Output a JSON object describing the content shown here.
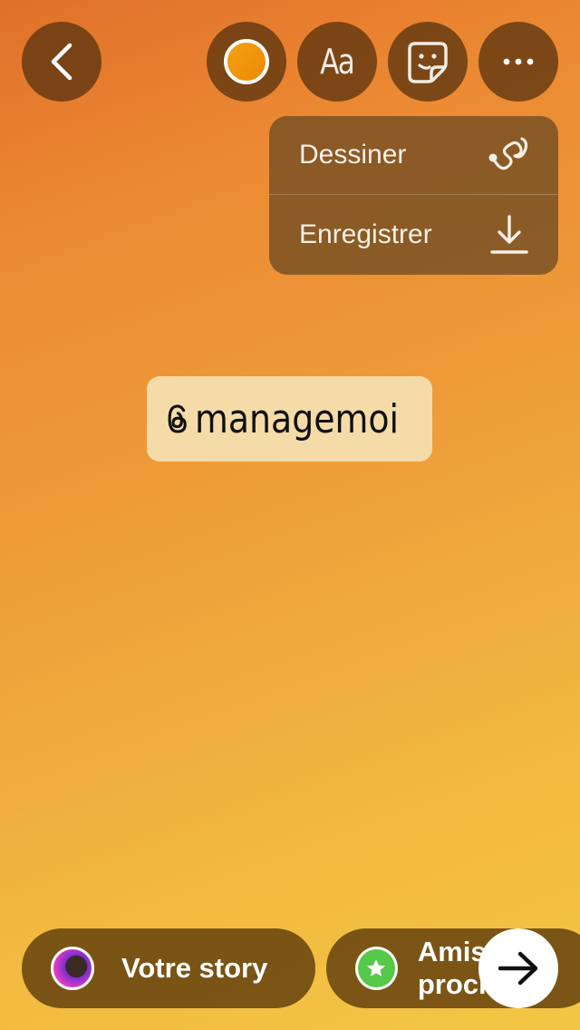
{
  "toolbar": {
    "back_icon": "chevron-left-icon",
    "color_icon": "color-picker-icon",
    "text_label": "Aa",
    "sticker_icon": "sticker-icon",
    "more_icon": "more-horizontal-icon"
  },
  "menu": {
    "items": [
      {
        "label": "Dessiner",
        "icon": "squiggle-draw-icon"
      },
      {
        "label": "Enregistrer",
        "icon": "download-icon"
      }
    ]
  },
  "sticker": {
    "icon": "threads-icon",
    "text": "managemoi"
  },
  "bottom": {
    "your_story": "Votre story",
    "close_friends": "Amis proches",
    "next_icon": "arrow-right-icon"
  },
  "colors": {
    "gradient_top": "#e0702a",
    "gradient_bottom": "#f4c644",
    "sticker_bg": "#f5dba7",
    "friends_badge": "#56c84a"
  }
}
